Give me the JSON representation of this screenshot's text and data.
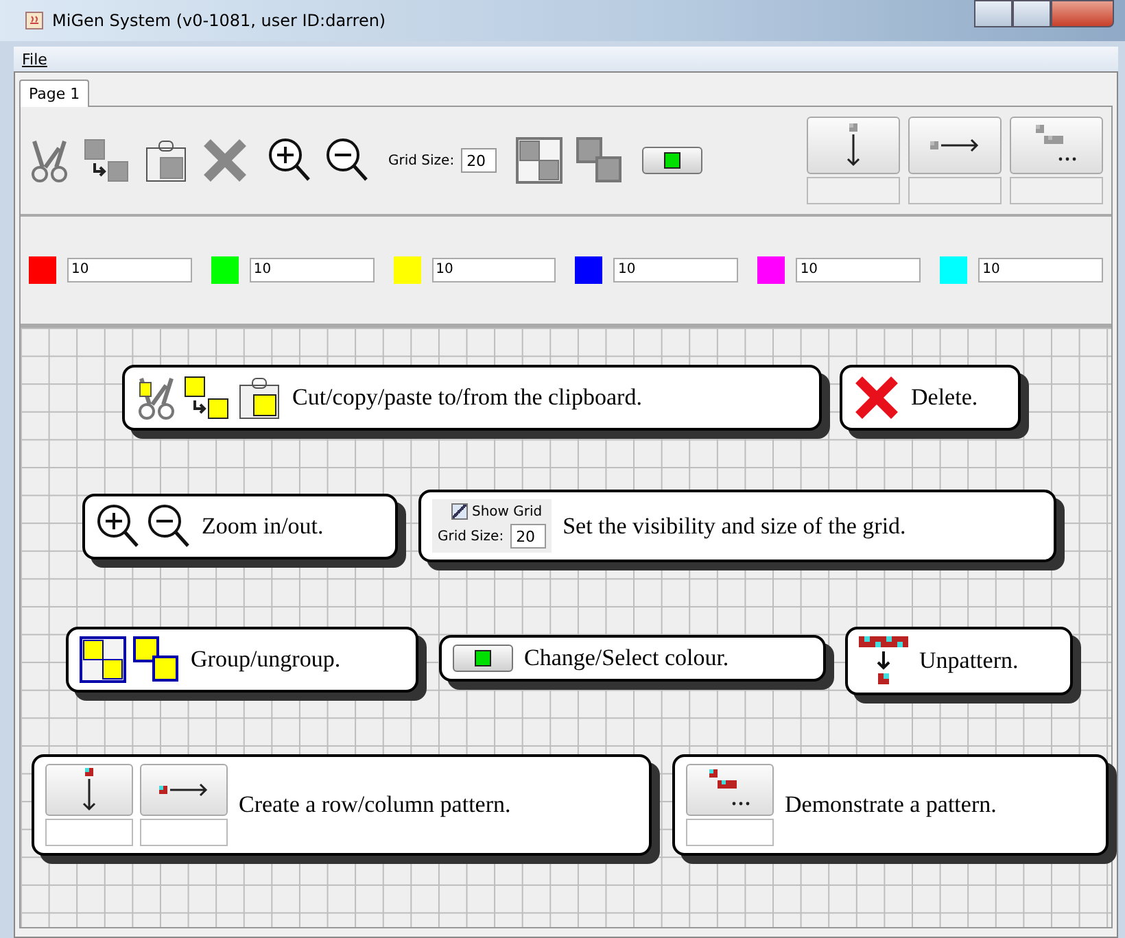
{
  "window": {
    "title": "MiGen System (v0-1081, user ID:darren)"
  },
  "menu": [
    "File"
  ],
  "tabs": [
    {
      "label": "Page 1",
      "selected": true
    }
  ],
  "toolbar": {
    "grid_size_label": "Grid Size:",
    "grid_size_value": "20"
  },
  "colours": [
    {
      "color": "#ff0000",
      "value": "10"
    },
    {
      "color": "#00ff00",
      "value": "10"
    },
    {
      "color": "#ffff00",
      "value": "10"
    },
    {
      "color": "#0000ff",
      "value": "10"
    },
    {
      "color": "#ff00ff",
      "value": "10"
    },
    {
      "color": "#00ffff",
      "value": "10"
    }
  ],
  "callouts": [
    {
      "kind": "clipboard",
      "text": "Cut/copy/paste to/from the clipboard."
    },
    {
      "kind": "delete",
      "text": "Delete."
    },
    {
      "kind": "zoom",
      "text": "Zoom in/out."
    },
    {
      "kind": "grid",
      "text": "Set the visibility and size of the grid.",
      "show_grid": {
        "label": "Show Grid",
        "checked": true
      },
      "grid_size_label": "Grid Size:",
      "grid_size_value": "20"
    },
    {
      "kind": "group",
      "text": "Group/ungroup."
    },
    {
      "kind": "colour",
      "text": "Change/Select colour."
    },
    {
      "kind": "unpattern",
      "text": "Unpattern."
    },
    {
      "kind": "create_pattern",
      "text": "Create a row/column pattern."
    },
    {
      "kind": "demonstrate",
      "text": "Demonstrate a pattern."
    }
  ]
}
